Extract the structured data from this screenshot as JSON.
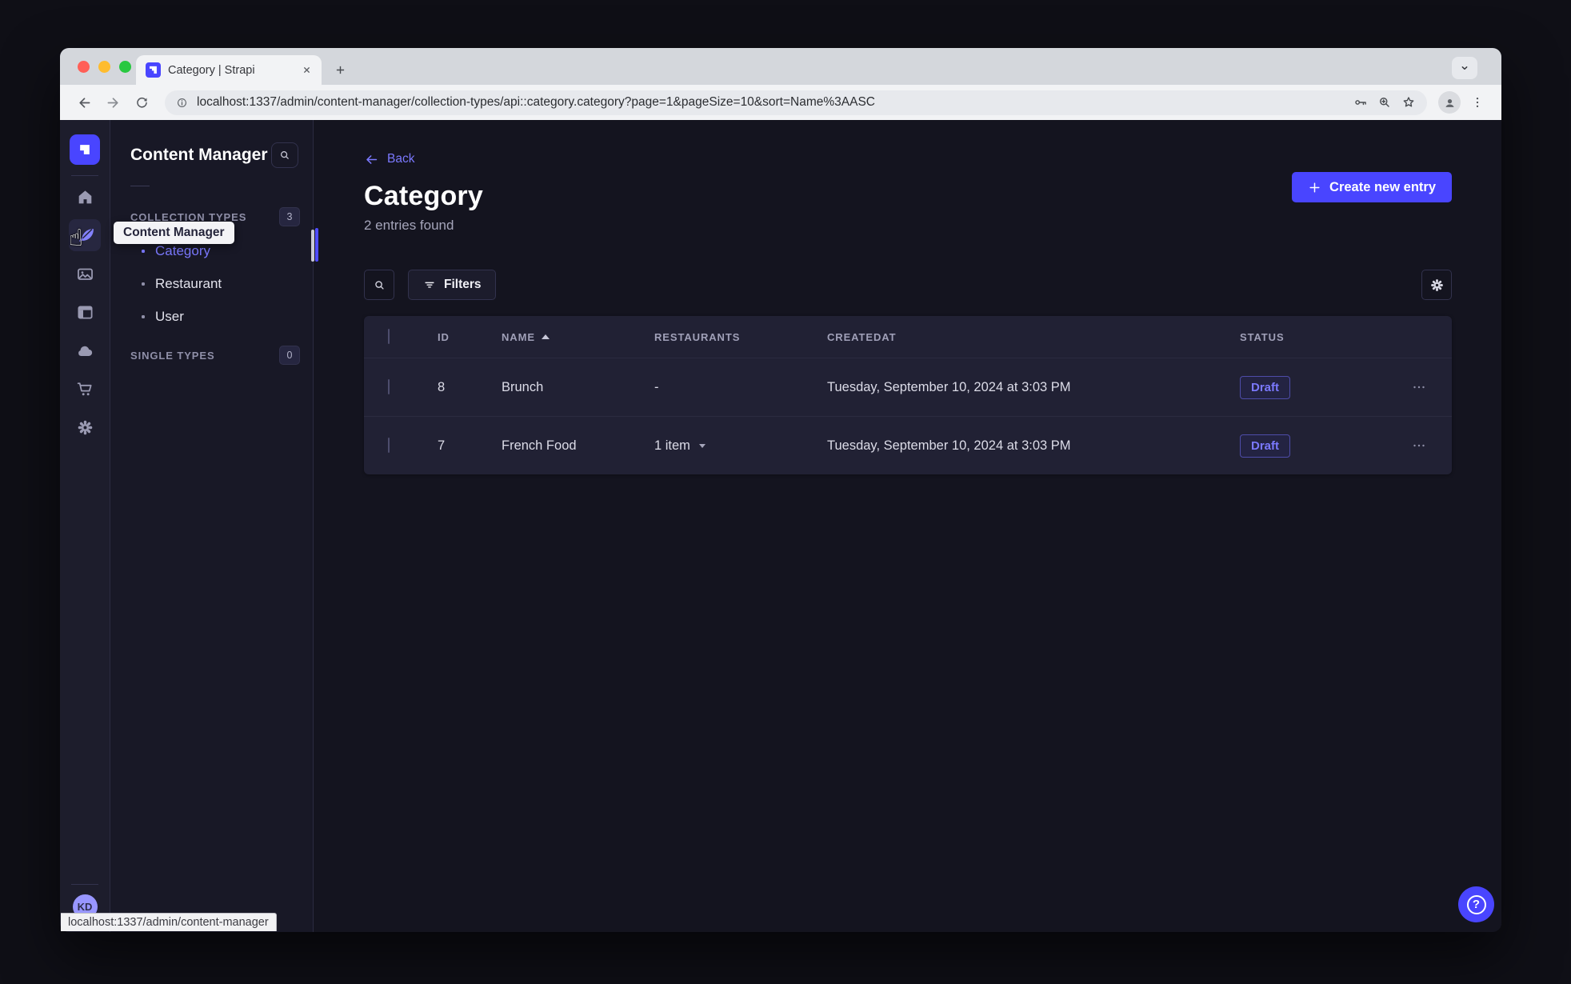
{
  "browser": {
    "tab_title": "Category | Strapi",
    "url": "localhost:1337/admin/content-manager/collection-types/api::category.category?page=1&pageSize=10&sort=Name%3AASC",
    "status_tooltip": "localhost:1337/admin/content-manager"
  },
  "rail": {
    "tooltip": "Content Manager",
    "avatar_initials": "KD"
  },
  "subnav": {
    "title": "Content Manager",
    "sections": {
      "collection": {
        "label": "COLLECTION TYPES",
        "count": "3"
      },
      "single": {
        "label": "SINGLE TYPES",
        "count": "0"
      }
    },
    "items": [
      {
        "label": "Category",
        "active": true
      },
      {
        "label": "Restaurant",
        "active": false
      },
      {
        "label": "User",
        "active": false
      }
    ]
  },
  "main": {
    "back_label": "Back",
    "title": "Category",
    "subtitle": "2 entries found",
    "create_button_label": "Create new entry",
    "filters_button_label": "Filters",
    "table": {
      "columns": [
        "ID",
        "NAME",
        "RESTAURANTS",
        "CREATEDAT",
        "STATUS"
      ],
      "rows": [
        {
          "id": "8",
          "name": "Brunch",
          "restaurants": "-",
          "created_at": "Tuesday, September 10, 2024 at 3:03 PM",
          "status": "Draft"
        },
        {
          "id": "7",
          "name": "French Food",
          "restaurants": "1 item",
          "created_at": "Tuesday, September 10, 2024 at 3:03 PM",
          "status": "Draft"
        }
      ]
    }
  },
  "help_label": "?",
  "colors": {
    "accent": "#4945ff",
    "accent_light": "#7b79ff",
    "page_bg": "#181826",
    "panel_bg": "#212134",
    "border": "#32324d"
  },
  "icons": {
    "rail": [
      "strapi-logo",
      "home-icon",
      "content-manager-icon",
      "media-library-icon",
      "content-type-builder-icon",
      "cloud-icon",
      "marketplace-icon",
      "settings-icon"
    ],
    "toolbar": [
      "back-icon",
      "forward-icon",
      "reload-icon",
      "info-icon",
      "key-icon",
      "zoom-plus-icon",
      "star-icon",
      "profile-icon",
      "kebab-menu-icon"
    ]
  }
}
